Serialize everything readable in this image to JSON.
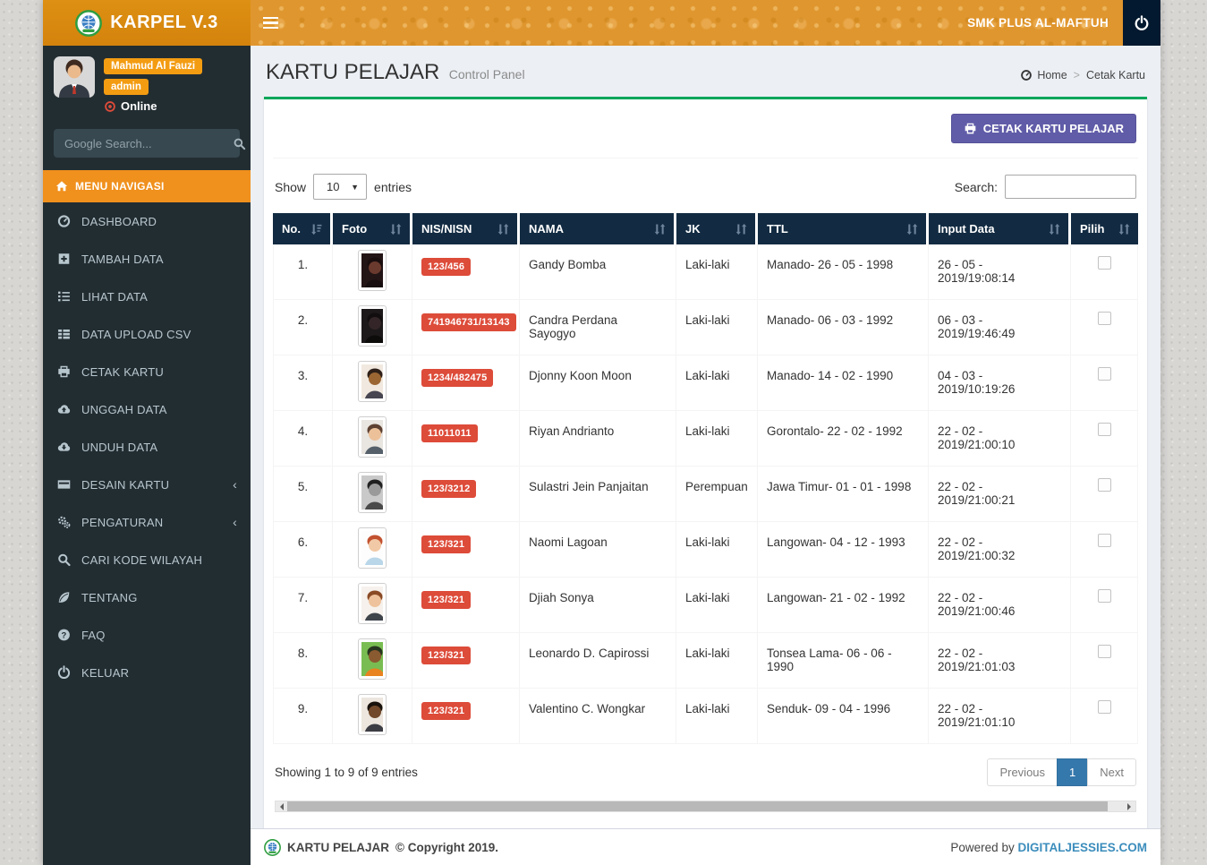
{
  "app": {
    "brand": "KARPEL V.3",
    "school_name": "SMK PLUS AL-MAFTUH"
  },
  "sidebar": {
    "user": {
      "name": "Mahmud Al Fauzi",
      "role_badge": "admin",
      "status": "Online"
    },
    "search_placeholder": "Google Search...",
    "menu_header": "MENU NAVIGASI",
    "menu": [
      {
        "id": "dashboard",
        "label": "DASHBOARD",
        "icon": "gauge",
        "has_submenu": false
      },
      {
        "id": "tambah-data",
        "label": "TAMBAH DATA",
        "icon": "plus-square",
        "has_submenu": false
      },
      {
        "id": "lihat-data",
        "label": "LIHAT DATA",
        "icon": "list-ol",
        "has_submenu": false
      },
      {
        "id": "data-upload-csv",
        "label": "DATA UPLOAD CSV",
        "icon": "th-list",
        "has_submenu": false
      },
      {
        "id": "cetak-kartu",
        "label": "CETAK KARTU",
        "icon": "print",
        "has_submenu": false
      },
      {
        "id": "unggah-data",
        "label": "UNGGAH DATA",
        "icon": "cloud-up",
        "has_submenu": false
      },
      {
        "id": "unduh-data",
        "label": "UNDUH DATA",
        "icon": "cloud-down",
        "has_submenu": false
      },
      {
        "id": "desain-kartu",
        "label": "DESAIN KARTU",
        "icon": "card",
        "has_submenu": true
      },
      {
        "id": "pengaturan",
        "label": "PENGATURAN",
        "icon": "gears",
        "has_submenu": true
      },
      {
        "id": "cari-kode-wilayah",
        "label": "CARI KODE WILAYAH",
        "icon": "search",
        "has_submenu": false
      },
      {
        "id": "tentang",
        "label": "TENTANG",
        "icon": "leaf",
        "has_submenu": false
      },
      {
        "id": "faq",
        "label": "FAQ",
        "icon": "question",
        "has_submenu": false
      },
      {
        "id": "keluar",
        "label": "KELUAR",
        "icon": "power",
        "has_submenu": false
      }
    ]
  },
  "content_header": {
    "title": "KARTU PELAJAR",
    "subtitle": "Control Panel",
    "breadcrumb": {
      "home": "Home",
      "current": "Cetak Kartu"
    }
  },
  "panel": {
    "print_button_label": "CETAK KARTU PELAJAR",
    "length_control": {
      "show_label": "Show",
      "selected": "10",
      "entries_label": "entries"
    },
    "search_control": {
      "label": "Search:",
      "value": ""
    },
    "table": {
      "columns": [
        "No.",
        "Foto",
        "NIS/NISN",
        "NAMA",
        "JK",
        "TTL",
        "Input Data",
        "Pilih"
      ],
      "rows": [
        {
          "no": "1.",
          "nis": "123/456",
          "nama": "Gandy Bomba",
          "jk": "Laki-laki",
          "ttl": "Manado- 26 - 05 - 1998",
          "input_data": "26 - 05 - 2019/19:08:14",
          "checked": false,
          "photo": {
            "bg": "#231416",
            "skin": "#6b3a2e",
            "hair": "#1a0d0e",
            "shirt": "#170d0e"
          }
        },
        {
          "no": "2.",
          "nis": "741946731/13143",
          "nama": "Candra Perdana Sayogyo",
          "jk": "Laki-laki",
          "ttl": "Manado- 06 - 03 - 1992",
          "input_data": "06 - 03 - 2019/19:46:49",
          "checked": false,
          "photo": {
            "bg": "#1d191a",
            "skin": "#342628",
            "hair": "#120e0f",
            "shirt": "#0e0b0b"
          }
        },
        {
          "no": "3.",
          "nis": "1234/482475",
          "nama": "Djonny Koon Moon",
          "jk": "Laki-laki",
          "ttl": "Manado- 14 - 02 - 1990",
          "input_data": "04 - 03 - 2019/10:19:26",
          "checked": false,
          "photo": {
            "bg": "#f1e9df",
            "skin": "#9c6633",
            "hair": "#2e2018",
            "shirt": "#474550"
          }
        },
        {
          "no": "4.",
          "nis": "11011011",
          "nama": "Riyan Andrianto",
          "jk": "Laki-laki",
          "ttl": "Gorontalo- 22 - 02 - 1992",
          "input_data": "22 - 02 - 2019/21:00:10",
          "checked": false,
          "photo": {
            "bg": "#e9e5e0",
            "skin": "#ecc19a",
            "hair": "#5d4031",
            "shirt": "#55606a"
          }
        },
        {
          "no": "5.",
          "nis": "123/3212",
          "nama": "Sulastri Jein Panjaitan",
          "jk": "Perempuan",
          "ttl": "Jawa Timur- 01 - 01 - 1998",
          "input_data": "22 - 02 - 2019/21:00:21",
          "checked": false,
          "photo": {
            "bg": "#c9c9c9",
            "skin": "#9a9a9a",
            "hair": "#202020",
            "shirt": "#4a4a4a"
          }
        },
        {
          "no": "6.",
          "nis": "123/321",
          "nama": "Naomi Lagoan",
          "jk": "Laki-laki",
          "ttl": "Langowan- 04 - 12 - 1993",
          "input_data": "22 - 02 - 2019/21:00:32",
          "checked": false,
          "photo": {
            "bg": "#fdfdfd",
            "skin": "#f2c9a6",
            "hair": "#c2512f",
            "shirt": "#bad7e9"
          }
        },
        {
          "no": "7.",
          "nis": "123/321",
          "nama": "Djiah Sonya",
          "jk": "Laki-laki",
          "ttl": "Langowan- 21 - 02 - 1992",
          "input_data": "22 - 02 - 2019/21:00:46",
          "checked": false,
          "photo": {
            "bg": "#f6f1ec",
            "skin": "#eec29c",
            "hair": "#8a4a26",
            "shirt": "#3f444b"
          }
        },
        {
          "no": "8.",
          "nis": "123/321",
          "nama": "Leonardo D. Capirossi",
          "jk": "Laki-laki",
          "ttl": "Tonsea Lama- 06 - 06 - 1990",
          "input_data": "22 - 02 - 2019/21:01:03",
          "checked": false,
          "photo": {
            "bg": "#79bd52",
            "skin": "#8a5a30",
            "hair": "#27351f",
            "shirt": "#e8831f"
          }
        },
        {
          "no": "9.",
          "nis": "123/321",
          "nama": "Valentino C. Wongkar",
          "jk": "Laki-laki",
          "ttl": "Senduk- 09 - 04 - 1996",
          "input_data": "22 - 02 - 2019/21:01:10",
          "checked": false,
          "photo": {
            "bg": "#ece6de",
            "skin": "#71482a",
            "hair": "#19120c",
            "shirt": "#3c3c44"
          }
        }
      ]
    },
    "info_text": "Showing 1 to 9 of 9 entries",
    "pagination": {
      "previous": "Previous",
      "current_page": "1",
      "next": "Next"
    }
  },
  "footer": {
    "copyright_app": "KARTU PELAJAR",
    "copyright_rest": "© Copyright 2019.",
    "powered_by": "Powered by",
    "vendor": "DIGITALJESSIES.COM"
  },
  "colors": {
    "navbar_orange": "#e0962e",
    "sidebar_dark": "#222d32",
    "accent_orange": "#f39c12",
    "box_accent_green": "#00a65a",
    "table_header_navy": "#122b42",
    "badge_red": "#dd4b39",
    "print_button_purple": "#605ca8",
    "active_page_blue": "#3578ac",
    "link_blue": "#3c8dbc",
    "online_red": "#dd4b39"
  }
}
